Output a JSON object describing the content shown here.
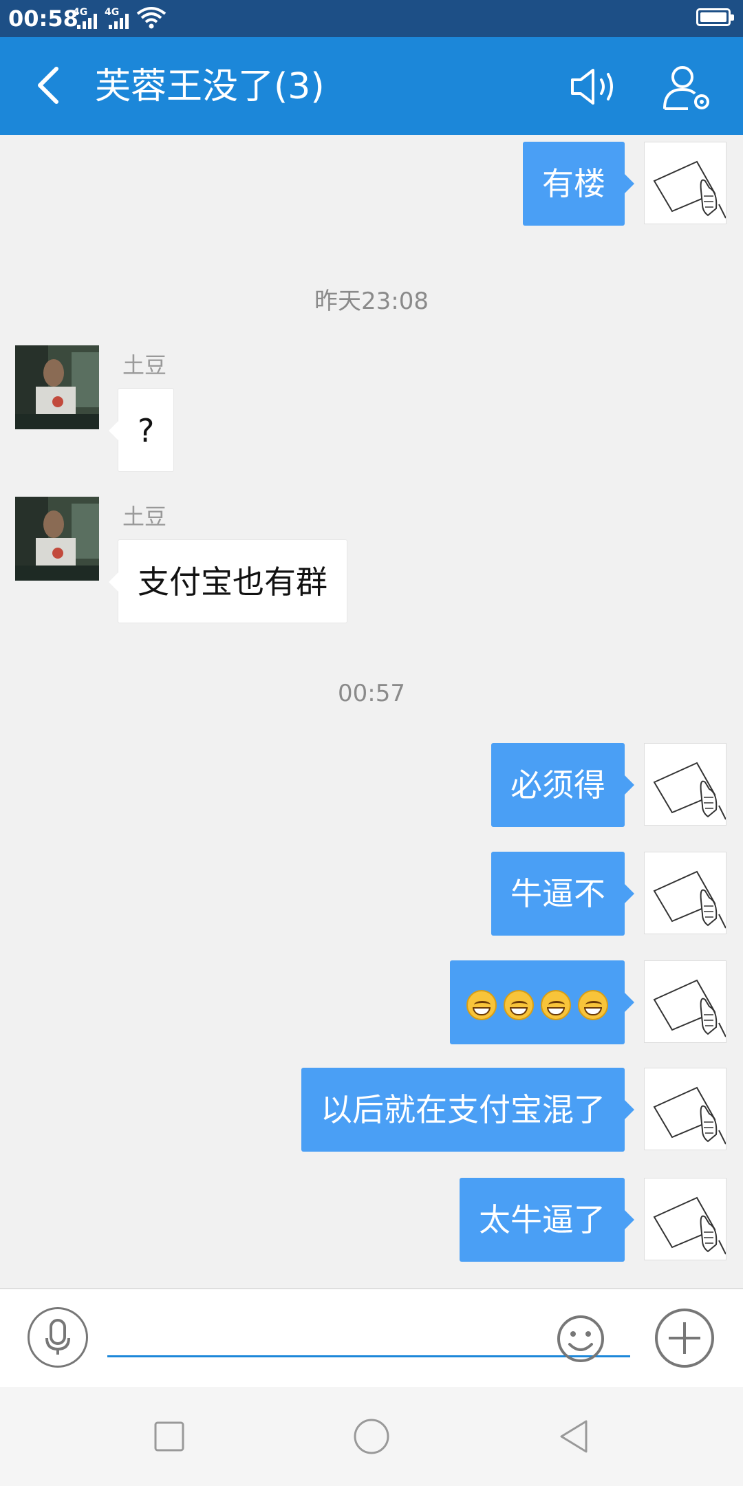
{
  "status_bar": {
    "time": "00:58",
    "network1": "4G",
    "network2": "4G"
  },
  "header": {
    "title": "芙蓉王没了(3)"
  },
  "messages": {
    "m1": "有楼",
    "ts1": "昨天23:08",
    "m2_sender": "土豆",
    "m2": "?",
    "m3_sender": "土豆",
    "m3": "支付宝也有群",
    "ts2": "00:57",
    "m4": "必须得",
    "m5": "牛逼不",
    "m7": "以后就在支付宝混了",
    "m8": "太牛逼了"
  },
  "input": {
    "value": "",
    "placeholder": ""
  },
  "colors": {
    "status_bar": "#1d4f86",
    "title_bar": "#1c87d9",
    "self_bubble": "#4a9ff5",
    "chat_bg": "#f1f1f1"
  },
  "icons": [
    "back-icon",
    "speaker-icon",
    "group-settings-icon",
    "microphone-icon",
    "smiley-icon",
    "plus-icon",
    "recent-apps-icon",
    "home-icon",
    "back-nav-icon"
  ]
}
